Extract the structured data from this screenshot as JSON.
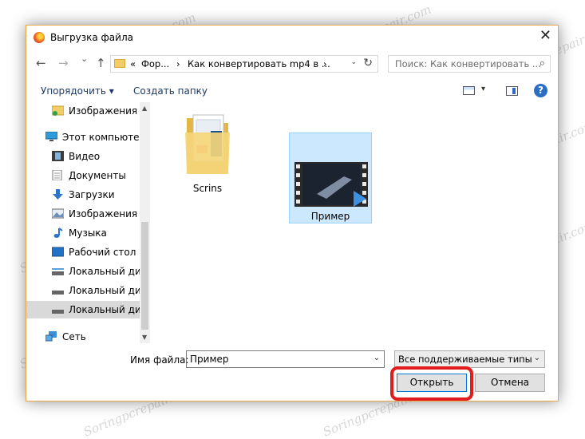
{
  "window": {
    "title": "Выгрузка файла",
    "close_glyph": "✕"
  },
  "nav": {
    "back_glyph": "←",
    "forward_glyph": "→",
    "recent_glyph": "⌄",
    "up_glyph": "↑",
    "breadcrumb": [
      "«",
      "Фор...",
      "›",
      "Как конвертировать mp4 в ...",
      "›"
    ],
    "dropdown_glyph": "⌄",
    "refresh_glyph": "↻",
    "search_placeholder": "Поиск: Как конвертировать ...",
    "search_glyph": "⌕"
  },
  "toolbar": {
    "organize_label": "Упорядочить ▾",
    "new_folder_label": "Создать папку",
    "view_dd_glyph": "▾",
    "help_glyph": "?"
  },
  "sidebar": {
    "items": [
      {
        "label": "Изображения",
        "icon": "pictures-icon"
      },
      {
        "label": "Этот компьютер",
        "icon": "computer-icon"
      },
      {
        "label": "Видео",
        "icon": "video-icon"
      },
      {
        "label": "Документы",
        "icon": "documents-icon"
      },
      {
        "label": "Загрузки",
        "icon": "downloads-icon"
      },
      {
        "label": "Изображения",
        "icon": "pictures-icon"
      },
      {
        "label": "Музыка",
        "icon": "music-icon"
      },
      {
        "label": "Рабочий стол",
        "icon": "desktop-icon"
      },
      {
        "label": "Локальный дис",
        "icon": "drive-icon"
      },
      {
        "label": "Локальный дис",
        "icon": "drive-icon"
      },
      {
        "label": "Локальный дис",
        "icon": "drive-icon",
        "selected": true
      },
      {
        "label": "Сеть",
        "icon": "network-icon"
      }
    ],
    "scroll_up": "▲",
    "scroll_down": "▼"
  },
  "files": [
    {
      "name": "Scrins",
      "kind": "folder"
    },
    {
      "name": "Пример",
      "kind": "video",
      "selected": true
    }
  ],
  "footer": {
    "filename_label": "Имя файла:",
    "filename_value": "Пример",
    "filetype_value": "Все поддерживаемые типы",
    "dd_glyph": "⌄",
    "open_label": "Открыть",
    "cancel_label": "Отмена"
  },
  "watermark": "Soringpcrepair.com",
  "colors": {
    "accent": "#0078d7",
    "highlight": "#e21c1c",
    "selection": "#cce8ff",
    "folder": "#f2cd68"
  }
}
